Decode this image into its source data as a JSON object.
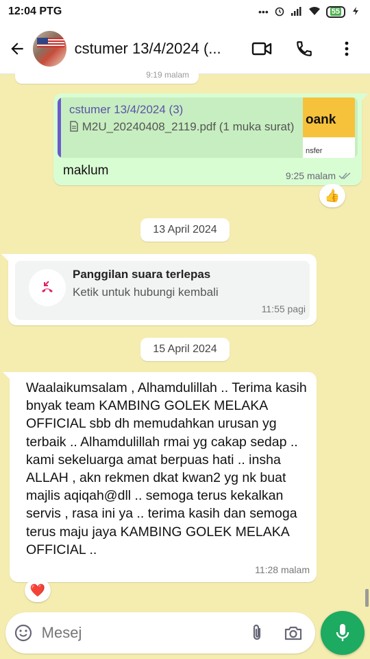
{
  "status_bar": {
    "time": "12:04 PTG",
    "battery": "55"
  },
  "header": {
    "title": "cstumer 13/4/2024 (..."
  },
  "prev_stub": {
    "time": "9:19 malam"
  },
  "outgoing": {
    "quote_name": "cstumer 13/4/2024 (3)",
    "quote_doc": "M2U_20240408_2119.pdf (1 muka surat)",
    "thumb_text_top": "oank",
    "thumb_text_bottom": "nsfer",
    "text": "maklum",
    "time": "9:25 malam",
    "reaction": "👍"
  },
  "date_chips": [
    "13 April 2024",
    "15 April 2024"
  ],
  "missed_call": {
    "title": "Panggilan suara terlepas",
    "subtitle": "Ketik untuk hubungi kembali",
    "time": "11:55 pagi"
  },
  "incoming": {
    "text": "Waalaikumsalam , Alhamdulillah .. Terima kasih bnyak team KAMBING GOLEK MELAKA OFFICIAL sbb dh memudahkan urusan yg terbaik .. Alhamdulillah rmai yg cakap sedap .. kami sekeluarga amat berpuas hati .. insha ALLAH , akn rekmen dkat kwan2 yg nk buat majlis aqiqah@dll .. semoga terus kekalkan servis , rasa ini ya .. terima kasih dan semoga terus maju jaya KAMBING GOLEK MELAKA OFFICIAL ..",
    "time": "11:28 malam",
    "reaction": "❤️"
  },
  "composer": {
    "placeholder": "Mesej"
  },
  "colors": {
    "wallpaper": "#f5ecb0",
    "outgoing_bubble": "#d9fdd3",
    "accent_green": "#1daa61",
    "quote_name": "#5a53a8",
    "missed_call_red": "#e0245e"
  },
  "icons": [
    "back-arrow-icon",
    "video-call-icon",
    "voice-call-icon",
    "more-vert-icon",
    "emoji-icon",
    "attach-icon",
    "camera-icon",
    "mic-icon",
    "missed-call-icon",
    "document-icon",
    "double-check-icon"
  ]
}
